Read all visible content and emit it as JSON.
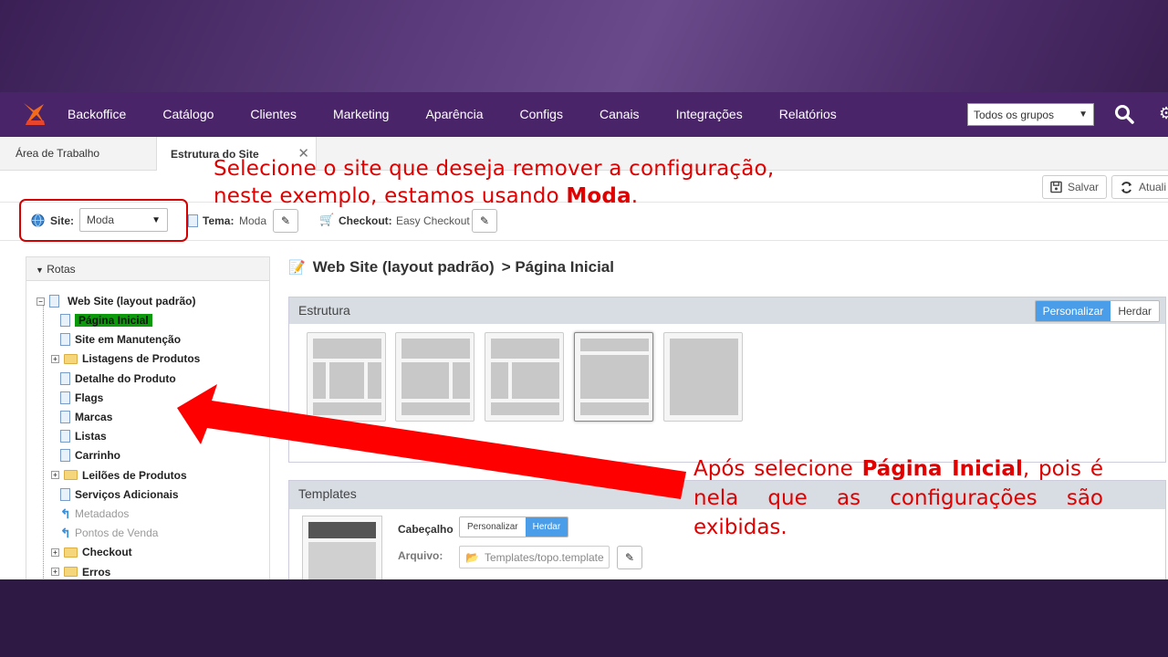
{
  "nav": {
    "items": [
      "Backoffice",
      "Catálogo",
      "Clientes",
      "Marketing",
      "Aparência",
      "Configs",
      "Canais",
      "Integrações",
      "Relatórios"
    ],
    "group_select": "Todos os grupos"
  },
  "tabs": {
    "tab1": "Área de Trabalho",
    "tab2": "Estrutura do Site"
  },
  "toolbar": {
    "save": "Salvar",
    "update": "Atuali"
  },
  "sitebar": {
    "site_label": "Site:",
    "site_value": "Moda",
    "tema_label": "Tema:",
    "tema_value": "Moda",
    "checkout_label": "Checkout:",
    "checkout_value": "Easy Checkout"
  },
  "tree": {
    "header": "Rotas",
    "root": "Web Site (layout padrão)",
    "items": [
      {
        "label": "Página Inicial",
        "type": "doc",
        "state": "selected"
      },
      {
        "label": "Site em Manutenção",
        "type": "doc"
      },
      {
        "label": "Listagens de Produtos",
        "type": "folder"
      },
      {
        "label": "Detalhe do Produto",
        "type": "doc"
      },
      {
        "label": "Flags",
        "type": "doc"
      },
      {
        "label": "Marcas",
        "type": "doc"
      },
      {
        "label": "Listas",
        "type": "doc"
      },
      {
        "label": "Carrinho",
        "type": "doc"
      },
      {
        "label": "Leilões de Produtos",
        "type": "folder"
      },
      {
        "label": "Serviços Adicionais",
        "type": "doc"
      },
      {
        "label": "Metadados",
        "type": "link",
        "state": "dim"
      },
      {
        "label": "Pontos de Venda",
        "type": "link",
        "state": "dim"
      },
      {
        "label": "Checkout",
        "type": "folder"
      },
      {
        "label": "Erros",
        "type": "folder"
      }
    ]
  },
  "main": {
    "title_part1": "Web Site (layout padrão)",
    "title_part2": "> Página Inicial",
    "estrutura": {
      "title": "Estrutura",
      "personalizar": "Personalizar",
      "herdar": "Herdar"
    },
    "templates": {
      "title": "Templates",
      "cabecalho_label": "Cabeçalho",
      "personalizar": "Personalizar",
      "herdar": "Herdar",
      "arquivo_label": "Arquivo:",
      "arquivo_value": "Templates/topo.template"
    }
  },
  "annotations": {
    "a1_line1": "Selecione o site que deseja remover a configuração,",
    "a1_line2_prefix": "neste exemplo, estamos usando ",
    "a1_line2_bold": "Moda",
    "a1_line2_suffix": ".",
    "a2_prefix": "Após selecione ",
    "a2_bold": "Página Inicial",
    "a2_suffix": ", pois é nela que as configurações são exibidas."
  },
  "colors": {
    "nav_bg": "#4a2468",
    "annotation_red": "#e00000",
    "selected_green": "#0a9a0a",
    "toggle_blue": "#4a9de8"
  }
}
